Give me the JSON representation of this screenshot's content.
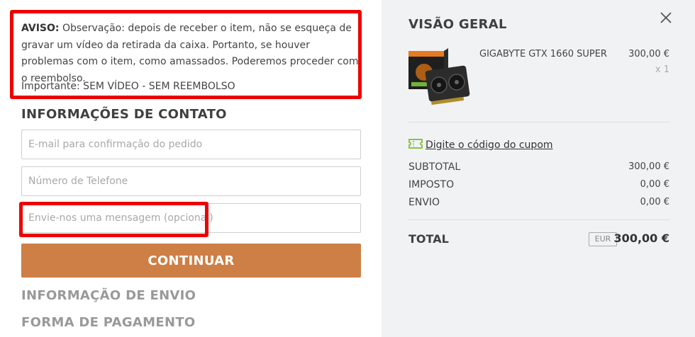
{
  "notice": {
    "label": "AVISO:",
    "text": "Observação: depois de receber o item, não se esqueça de gravar um vídeo da retirada da caixa. Portanto, se houver problemas com o item, como amassados. Poderemos proceder com o reembolso.",
    "important": "Importante: SEM VÍDEO - SEM REEMBOLSO"
  },
  "contact": {
    "title": "INFORMAÇÕES DE CONTATO",
    "email_placeholder": "E-mail para confirmação do pedido",
    "phone_placeholder": "Número de Telefone",
    "message_placeholder": "Envie-nos uma mensagem (opcional)",
    "continue_label": "CONTINUAR"
  },
  "steps": {
    "shipping": "INFORMAÇÃO DE ENVIO",
    "payment": "FORMA DE PAGAMENTO"
  },
  "overview": {
    "title": "VISÃO GERAL",
    "close_icon": "close-icon",
    "product": {
      "name": "GIGABYTE GTX 1660 SUPER",
      "price": "300,00 €",
      "qty": "x 1",
      "image_icon": "graphics-card-image"
    },
    "coupon_label": "Digite o código do cupom",
    "coupon_icon": "ticket-icon",
    "subtotal_label": "SUBTOTAL",
    "subtotal_value": "300,00 €",
    "tax_label": "IMPOSTO",
    "tax_value": "0,00 €",
    "shipping_label": "ENVIO",
    "shipping_value": "0,00 €",
    "total_label": "TOTAL",
    "currency": "EUR",
    "total_value": "300,00 €"
  },
  "colors": {
    "accent": "#cd7f45",
    "highlight": "#ee0000",
    "coupon_icon": "#8bc34a",
    "sidebar_bg": "#f1f2f4"
  }
}
